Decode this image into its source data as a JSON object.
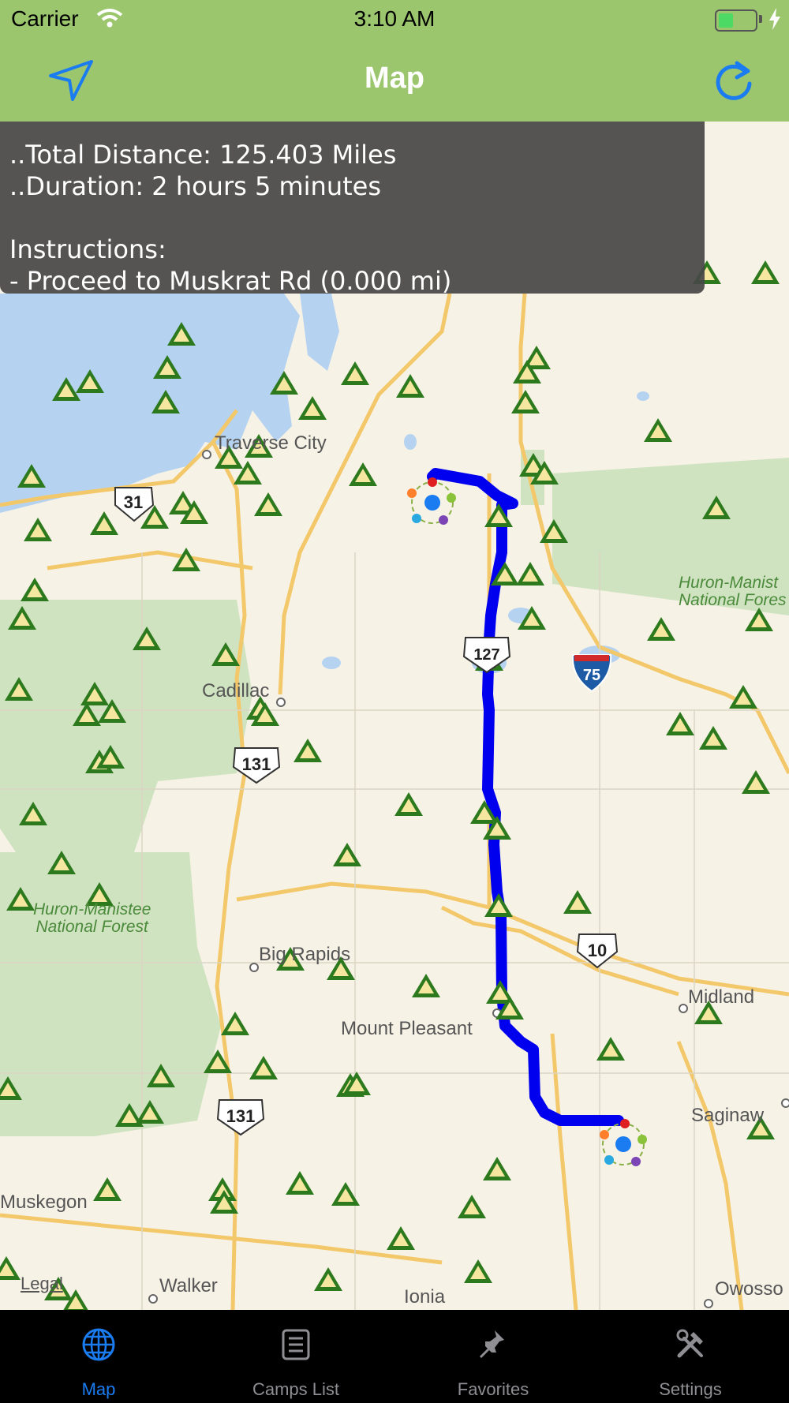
{
  "status_bar": {
    "carrier": "Carrier",
    "time": "3:10 AM"
  },
  "nav": {
    "title": "Map"
  },
  "info_panel": {
    "total_distance": "..Total Distance: 125.403 Miles",
    "duration": "..Duration: 2 hours 5 minutes",
    "instructions_heading": "Instructions:",
    "instruction_1": "- Proceed to Muskrat Rd (0.000 mi)"
  },
  "map": {
    "places": {
      "traverse_city": "Traverse City",
      "cadillac": "Cadillac",
      "big_rapids": "Big Rapids",
      "mount_pleasant": "Mount Pleasant",
      "midland": "Midland",
      "saginaw": "Saginaw",
      "muskegon": "Muskegon",
      "walker": "Walker",
      "ionia": "Ionia",
      "owosso": "Owosso"
    },
    "forests": {
      "huron_manistee_west_1": "Huron-Manistee",
      "huron_manistee_west_2": "National Forest",
      "huron_manistee_east_1": "Huron-Manist",
      "huron_manistee_east_2": "National Fores"
    },
    "shields": {
      "us31": "31",
      "us131_a": "131",
      "us131_b": "131",
      "us10": "10",
      "us127": "127",
      "i75": "75"
    },
    "legal": "Legal",
    "route_color": "#0000ee",
    "campsite_color": "#2d7a1e"
  },
  "tabs": [
    {
      "label": "Map",
      "icon": "globe-icon",
      "active": true
    },
    {
      "label": "Camps List",
      "icon": "list-icon",
      "active": false
    },
    {
      "label": "Favorites",
      "icon": "pin-icon",
      "active": false
    },
    {
      "label": "Settings",
      "icon": "tools-icon",
      "active": false
    }
  ]
}
